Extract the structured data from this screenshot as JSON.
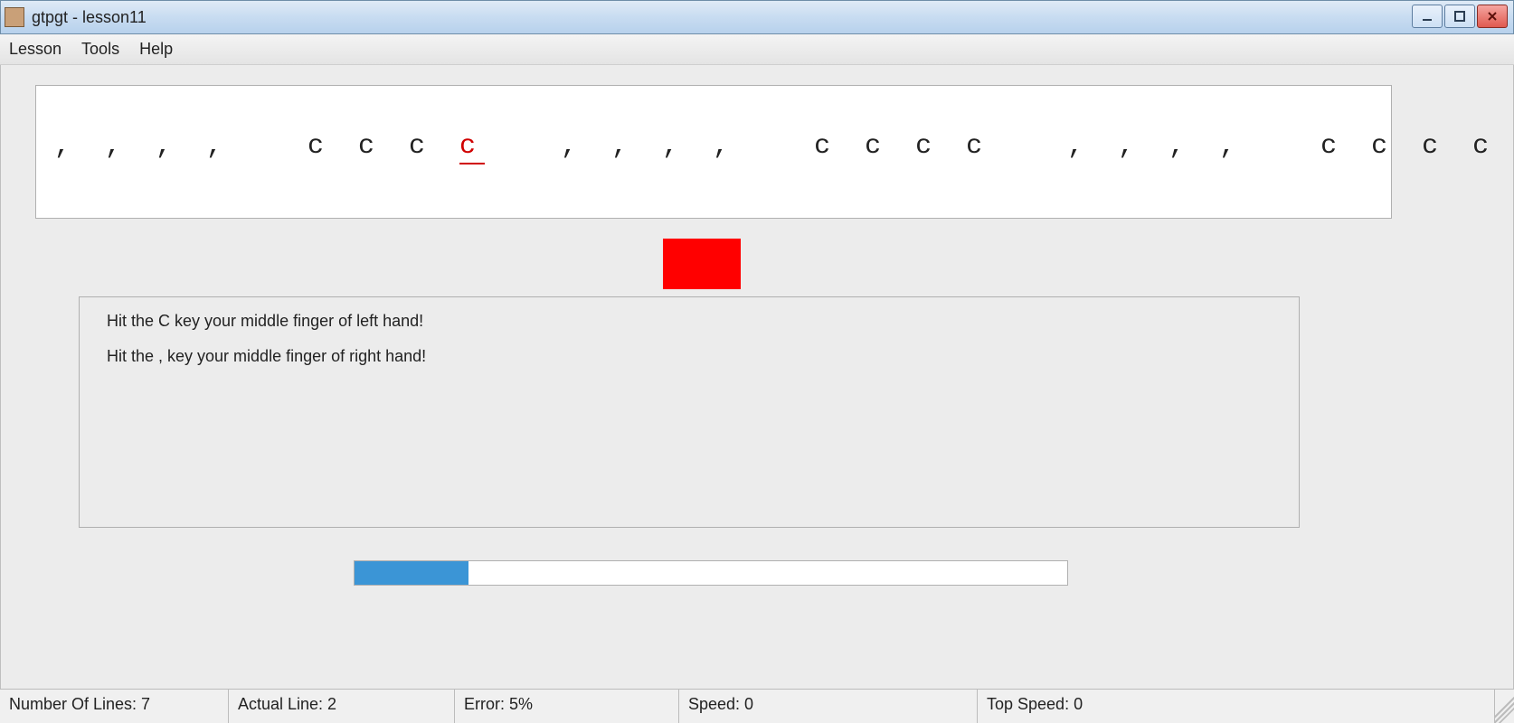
{
  "window": {
    "title": "gtpgt - lesson11"
  },
  "menu": {
    "lesson": "Lesson",
    "tools": "Tools",
    "help": "Help"
  },
  "lesson": {
    "typed_before_cursor": ", , , ,   c c c ",
    "cursor_char": "c",
    "remaining": "   , , , ,   c c c c   , , , ,   c c c c   , , , ,   c c c c   , , , ¬"
  },
  "hints": {
    "line1": "Hit the C key your middle finger of left hand!",
    "line2": "Hit the , key your middle finger of right hand!"
  },
  "progress": {
    "percent": 16
  },
  "status": {
    "lines_label": "Number Of Lines: 7",
    "actual_line_label": "Actual Line: 2",
    "error_label": "Error: 5%",
    "speed_label": "Speed: 0",
    "top_speed_label": "Top Speed: 0"
  },
  "colors": {
    "indicator": "#ff0000",
    "progress_fill": "#3b95d6",
    "cursor": "#d00000"
  }
}
